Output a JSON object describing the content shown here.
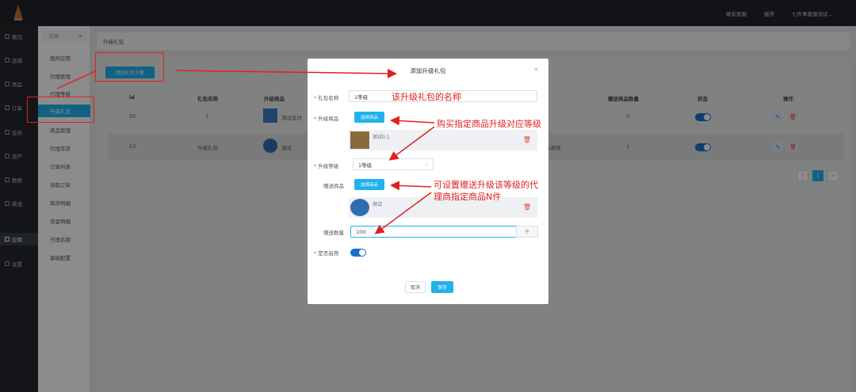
{
  "topbar": {
    "links": [
      "联系客服",
      "缓存",
      "七件事客服测试..."
    ]
  },
  "leftnav": {
    "items": [
      "概况",
      "店铺",
      "商品",
      "订单",
      "会员",
      "资产",
      "数据",
      "渠道",
      "应用",
      "设置"
    ]
  },
  "submenu": {
    "head": "应用",
    "head_icon": "≡",
    "items": [
      "我的应用",
      "代理管理",
      "代理等级",
      "升级礼包",
      "商品管理",
      "代理库存",
      "订单列表",
      "自取订单",
      "库存明细",
      "资金明细",
      "代理名额",
      "基础配置"
    ]
  },
  "breadcrumb": "升级礼包",
  "add_button": "添加礼包方案",
  "table": {
    "headers": [
      "id",
      "礼包名称",
      "升级商品",
      "赠送商品数量",
      "状态",
      "操作"
    ],
    "rows": [
      {
        "id": "55",
        "name": "1",
        "product": "测试支付",
        "gift_count": "0"
      },
      {
        "id": "53",
        "name": "升级礼包",
        "product": "测试",
        "extra": "1减领",
        "gift_count": "1"
      }
    ]
  },
  "pager": {
    "prev": "‹",
    "current": "1",
    "next": "›"
  },
  "modal": {
    "title": "添加升级礼包",
    "close": "×",
    "fields": {
      "name_label": "礼包名称",
      "name_value": "1等级",
      "upgrade_product_label": "升级商品",
      "select_product_btn": "选择商品",
      "upgrade_product_name": "测试0.1",
      "level_label": "升级等级",
      "level_value": "1等级",
      "gift_product_label": "赠送商品",
      "gift_product_name": "测试",
      "gift_qty_label": "赠送数量",
      "gift_qty_value": "100",
      "gift_qty_unit": "件",
      "enable_label": "是否启用"
    },
    "cancel": "取消",
    "save": "保存"
  },
  "annotations": {
    "name_note": "该升级礼包的名称",
    "product_note": "购买指定商品升级对应等级",
    "gift_note_1": "可设置赠送升级该等级的代",
    "gift_note_2": "理商指定商品N件"
  },
  "colors": {
    "accent": "#1fb2ec",
    "annotation": "#e02020",
    "toggle": "#1a6fc9"
  }
}
